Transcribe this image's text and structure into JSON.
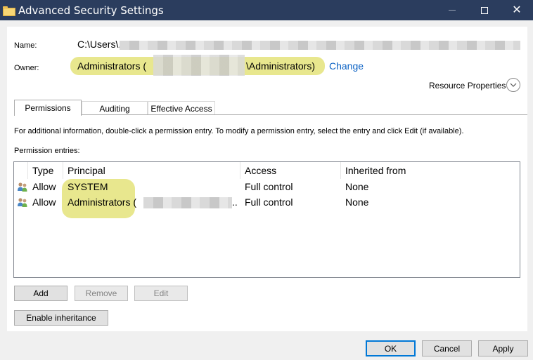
{
  "window": {
    "title": "Advanced Security Settings",
    "minimize": "—",
    "close": "✕"
  },
  "name_row": {
    "label": "Name:",
    "value": "C:\\Users\\."
  },
  "owner_row": {
    "label": "Owner:",
    "value_prefix": "Administrators (",
    "value_suffix": "\\Administrators)",
    "change_link": "Change"
  },
  "resource_properties": "Resource Properties",
  "tabs": [
    {
      "label": "Permissions",
      "active": true
    },
    {
      "label": "Auditing",
      "active": false
    },
    {
      "label": "Effective Access",
      "active": false
    }
  ],
  "info_text": "For additional information, double-click a permission entry. To modify a permission entry, select the entry and click Edit (if available).",
  "entries_label": "Permission entries:",
  "table": {
    "columns": [
      "Type",
      "Principal",
      "Access",
      "Inherited from"
    ],
    "rows": [
      {
        "type": "Allow",
        "principal": "SYSTEM",
        "access": "Full control",
        "inherited": "None"
      },
      {
        "type": "Allow",
        "principal": "Administrators (",
        "principal_suffix": "..",
        "access": "Full control",
        "inherited": "None"
      }
    ]
  },
  "buttons": {
    "add": "Add",
    "remove": "Remove",
    "edit": "Edit",
    "enable_inheritance": "Enable inheritance",
    "ok": "OK",
    "cancel": "Cancel",
    "apply": "Apply"
  },
  "colors": {
    "titlebar": "#2b3d5e",
    "highlight": "#e8e78e",
    "link": "#0b62c4",
    "default_button_border": "#0078d7"
  }
}
